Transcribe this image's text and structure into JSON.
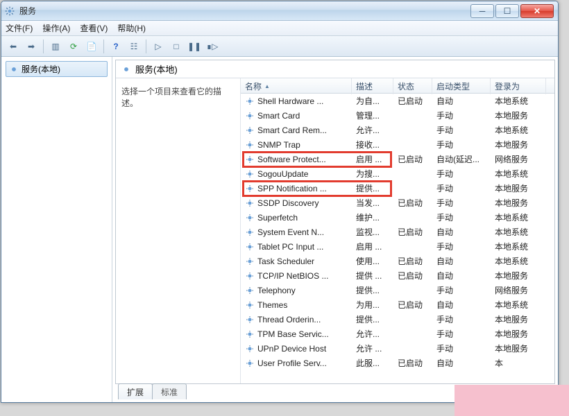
{
  "window": {
    "title": "服务",
    "min_glyph": "─",
    "max_glyph": "☐",
    "close_glyph": "✕"
  },
  "menu": {
    "file": "文件(F)",
    "action": "操作(A)",
    "view": "查看(V)",
    "help": "帮助(H)"
  },
  "tree": {
    "root": "服务(本地)"
  },
  "panel": {
    "heading": "服务(本地)",
    "instruction": "选择一个项目来查看它的描述。"
  },
  "columns": {
    "name": "名称",
    "desc": "描述",
    "status": "状态",
    "startup": "启动类型",
    "logon": "登录为"
  },
  "tabs": {
    "extended": "扩展",
    "standard": "标准"
  },
  "rows": [
    {
      "name": "Shell Hardware ...",
      "desc": "为自...",
      "status": "已启动",
      "startup": "自动",
      "logon": "本地系统"
    },
    {
      "name": "Smart Card",
      "desc": "管理...",
      "status": "",
      "startup": "手动",
      "logon": "本地服务"
    },
    {
      "name": "Smart Card Rem...",
      "desc": "允许...",
      "status": "",
      "startup": "手动",
      "logon": "本地系统"
    },
    {
      "name": "SNMP Trap",
      "desc": "接收...",
      "status": "",
      "startup": "手动",
      "logon": "本地服务"
    },
    {
      "name": "Software Protect...",
      "desc": "启用 ...",
      "status": "已启动",
      "startup": "自动(延迟...",
      "logon": "网络服务"
    },
    {
      "name": "SogouUpdate",
      "desc": "为搜...",
      "status": "",
      "startup": "手动",
      "logon": "本地系统"
    },
    {
      "name": "SPP Notification ...",
      "desc": "提供...",
      "status": "",
      "startup": "手动",
      "logon": "本地服务"
    },
    {
      "name": "SSDP Discovery",
      "desc": "当发...",
      "status": "已启动",
      "startup": "手动",
      "logon": "本地服务"
    },
    {
      "name": "Superfetch",
      "desc": "维护...",
      "status": "",
      "startup": "手动",
      "logon": "本地系统"
    },
    {
      "name": "System Event N...",
      "desc": "监视...",
      "status": "已启动",
      "startup": "自动",
      "logon": "本地系统"
    },
    {
      "name": "Tablet PC Input ...",
      "desc": "启用 ...",
      "status": "",
      "startup": "手动",
      "logon": "本地系统"
    },
    {
      "name": "Task Scheduler",
      "desc": "使用...",
      "status": "已启动",
      "startup": "自动",
      "logon": "本地系统"
    },
    {
      "name": "TCP/IP NetBIOS ...",
      "desc": "提供 ...",
      "status": "已启动",
      "startup": "自动",
      "logon": "本地服务"
    },
    {
      "name": "Telephony",
      "desc": "提供...",
      "status": "",
      "startup": "手动",
      "logon": "网络服务"
    },
    {
      "name": "Themes",
      "desc": "为用...",
      "status": "已启动",
      "startup": "自动",
      "logon": "本地系统"
    },
    {
      "name": "Thread Orderin...",
      "desc": "提供...",
      "status": "",
      "startup": "手动",
      "logon": "本地服务"
    },
    {
      "name": "TPM Base Servic...",
      "desc": "允许...",
      "status": "",
      "startup": "手动",
      "logon": "本地服务"
    },
    {
      "name": "UPnP Device Host",
      "desc": "允许 ...",
      "status": "",
      "startup": "手动",
      "logon": "本地服务"
    },
    {
      "name": "User Profile Serv...",
      "desc": "此服...",
      "status": "已启动",
      "startup": "自动",
      "logon": "本"
    }
  ]
}
